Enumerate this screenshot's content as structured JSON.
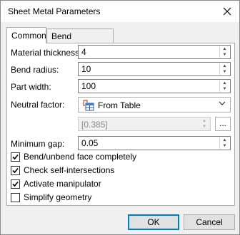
{
  "window": {
    "title": "Sheet Metal Parameters"
  },
  "tabs": [
    {
      "label": "Common",
      "active": true
    },
    {
      "label": "Bend Parameters",
      "active": false
    }
  ],
  "fields": {
    "material_thickness": {
      "label": "Material thickness:",
      "value": "4"
    },
    "bend_radius": {
      "label": "Bend radius:",
      "value": "10"
    },
    "part_width": {
      "label": "Part width:",
      "value": "100"
    },
    "neutral_factor": {
      "label": "Neutral factor:",
      "selected": "From Table",
      "icon": "table-icon"
    },
    "neutral_value": {
      "value": "[0.385]",
      "ellipsis": "..."
    },
    "minimum_gap": {
      "label": "Minimum gap:",
      "value": "0.05"
    }
  },
  "checkboxes": [
    {
      "label": "Bend/unbend face completely",
      "checked": true
    },
    {
      "label": "Check self-intersections",
      "checked": true
    },
    {
      "label": "Activate manipulator",
      "checked": true
    },
    {
      "label": "Simplify geometry",
      "checked": false
    }
  ],
  "buttons": {
    "ok": "OK",
    "cancel": "Cancel"
  },
  "colors": {
    "accent": "#0078d7"
  }
}
